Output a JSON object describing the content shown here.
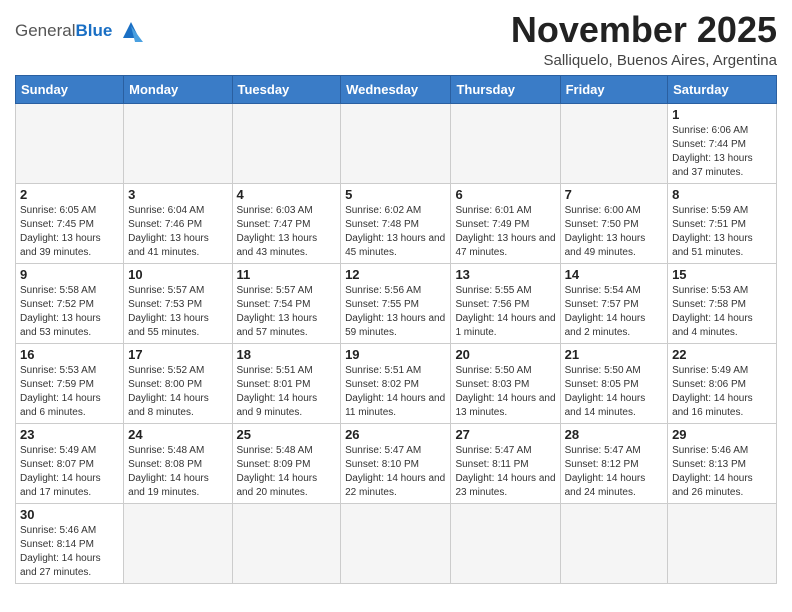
{
  "header": {
    "logo_general": "General",
    "logo_blue": "Blue",
    "month_title": "November 2025",
    "location": "Salliquelo, Buenos Aires, Argentina"
  },
  "weekdays": [
    "Sunday",
    "Monday",
    "Tuesday",
    "Wednesday",
    "Thursday",
    "Friday",
    "Saturday"
  ],
  "weeks": [
    [
      {
        "day": "",
        "empty": true
      },
      {
        "day": "",
        "empty": true
      },
      {
        "day": "",
        "empty": true
      },
      {
        "day": "",
        "empty": true
      },
      {
        "day": "",
        "empty": true
      },
      {
        "day": "",
        "empty": true
      },
      {
        "day": "1",
        "sunrise": "6:06 AM",
        "sunset": "7:44 PM",
        "daylight": "13 hours and 37 minutes."
      }
    ],
    [
      {
        "day": "2",
        "sunrise": "6:05 AM",
        "sunset": "7:45 PM",
        "daylight": "13 hours and 39 minutes."
      },
      {
        "day": "3",
        "sunrise": "6:04 AM",
        "sunset": "7:46 PM",
        "daylight": "13 hours and 41 minutes."
      },
      {
        "day": "4",
        "sunrise": "6:03 AM",
        "sunset": "7:47 PM",
        "daylight": "13 hours and 43 minutes."
      },
      {
        "day": "5",
        "sunrise": "6:02 AM",
        "sunset": "7:48 PM",
        "daylight": "13 hours and 45 minutes."
      },
      {
        "day": "6",
        "sunrise": "6:01 AM",
        "sunset": "7:49 PM",
        "daylight": "13 hours and 47 minutes."
      },
      {
        "day": "7",
        "sunrise": "6:00 AM",
        "sunset": "7:50 PM",
        "daylight": "13 hours and 49 minutes."
      },
      {
        "day": "8",
        "sunrise": "5:59 AM",
        "sunset": "7:51 PM",
        "daylight": "13 hours and 51 minutes."
      }
    ],
    [
      {
        "day": "9",
        "sunrise": "5:58 AM",
        "sunset": "7:52 PM",
        "daylight": "13 hours and 53 minutes."
      },
      {
        "day": "10",
        "sunrise": "5:57 AM",
        "sunset": "7:53 PM",
        "daylight": "13 hours and 55 minutes."
      },
      {
        "day": "11",
        "sunrise": "5:57 AM",
        "sunset": "7:54 PM",
        "daylight": "13 hours and 57 minutes."
      },
      {
        "day": "12",
        "sunrise": "5:56 AM",
        "sunset": "7:55 PM",
        "daylight": "13 hours and 59 minutes."
      },
      {
        "day": "13",
        "sunrise": "5:55 AM",
        "sunset": "7:56 PM",
        "daylight": "14 hours and 1 minute."
      },
      {
        "day": "14",
        "sunrise": "5:54 AM",
        "sunset": "7:57 PM",
        "daylight": "14 hours and 2 minutes."
      },
      {
        "day": "15",
        "sunrise": "5:53 AM",
        "sunset": "7:58 PM",
        "daylight": "14 hours and 4 minutes."
      }
    ],
    [
      {
        "day": "16",
        "sunrise": "5:53 AM",
        "sunset": "7:59 PM",
        "daylight": "14 hours and 6 minutes."
      },
      {
        "day": "17",
        "sunrise": "5:52 AM",
        "sunset": "8:00 PM",
        "daylight": "14 hours and 8 minutes."
      },
      {
        "day": "18",
        "sunrise": "5:51 AM",
        "sunset": "8:01 PM",
        "daylight": "14 hours and 9 minutes."
      },
      {
        "day": "19",
        "sunrise": "5:51 AM",
        "sunset": "8:02 PM",
        "daylight": "14 hours and 11 minutes."
      },
      {
        "day": "20",
        "sunrise": "5:50 AM",
        "sunset": "8:03 PM",
        "daylight": "14 hours and 13 minutes."
      },
      {
        "day": "21",
        "sunrise": "5:50 AM",
        "sunset": "8:05 PM",
        "daylight": "14 hours and 14 minutes."
      },
      {
        "day": "22",
        "sunrise": "5:49 AM",
        "sunset": "8:06 PM",
        "daylight": "14 hours and 16 minutes."
      }
    ],
    [
      {
        "day": "23",
        "sunrise": "5:49 AM",
        "sunset": "8:07 PM",
        "daylight": "14 hours and 17 minutes."
      },
      {
        "day": "24",
        "sunrise": "5:48 AM",
        "sunset": "8:08 PM",
        "daylight": "14 hours and 19 minutes."
      },
      {
        "day": "25",
        "sunrise": "5:48 AM",
        "sunset": "8:09 PM",
        "daylight": "14 hours and 20 minutes."
      },
      {
        "day": "26",
        "sunrise": "5:47 AM",
        "sunset": "8:10 PM",
        "daylight": "14 hours and 22 minutes."
      },
      {
        "day": "27",
        "sunrise": "5:47 AM",
        "sunset": "8:11 PM",
        "daylight": "14 hours and 23 minutes."
      },
      {
        "day": "28",
        "sunrise": "5:47 AM",
        "sunset": "8:12 PM",
        "daylight": "14 hours and 24 minutes."
      },
      {
        "day": "29",
        "sunrise": "5:46 AM",
        "sunset": "8:13 PM",
        "daylight": "14 hours and 26 minutes."
      }
    ],
    [
      {
        "day": "30",
        "sunrise": "5:46 AM",
        "sunset": "8:14 PM",
        "daylight": "14 hours and 27 minutes."
      },
      {
        "day": "",
        "empty": true
      },
      {
        "day": "",
        "empty": true
      },
      {
        "day": "",
        "empty": true
      },
      {
        "day": "",
        "empty": true
      },
      {
        "day": "",
        "empty": true
      },
      {
        "day": "",
        "empty": true
      }
    ]
  ],
  "labels": {
    "sunrise_prefix": "Sunrise: ",
    "sunset_prefix": "Sunset: ",
    "daylight_prefix": "Daylight: "
  }
}
